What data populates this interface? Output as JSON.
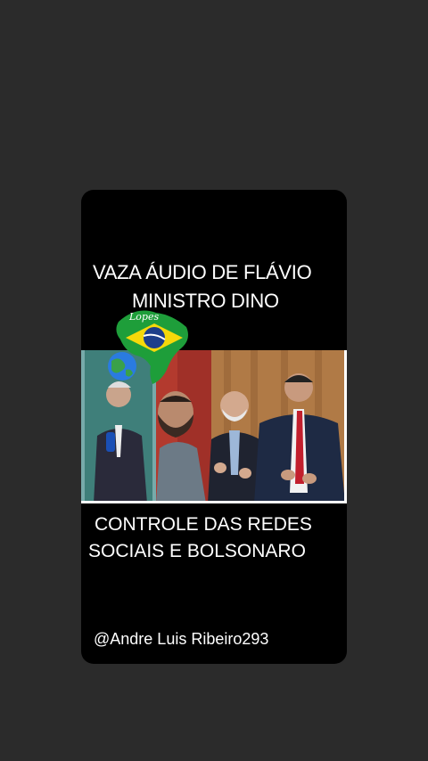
{
  "post": {
    "headline_line1": "VAZA  ÁUDIO DE FLÁVIO",
    "headline_line2": "MINISTRO DINO",
    "subtitle_line1": "CONTROLE DAS REDES",
    "subtitle_line2": "SOCIAIS E BOLSONARO",
    "handle": "@Andre Luis Ribeiro293"
  },
  "badge": {
    "text": "Lopes",
    "icon": "brazil-map-flag-icon"
  },
  "colors": {
    "background": "#2b2b2b",
    "card": "#000000",
    "text": "#ffffff",
    "flag_green": "#1e9e3a",
    "flag_yellow": "#f5d90a",
    "flag_blue": "#1d3f8a"
  }
}
